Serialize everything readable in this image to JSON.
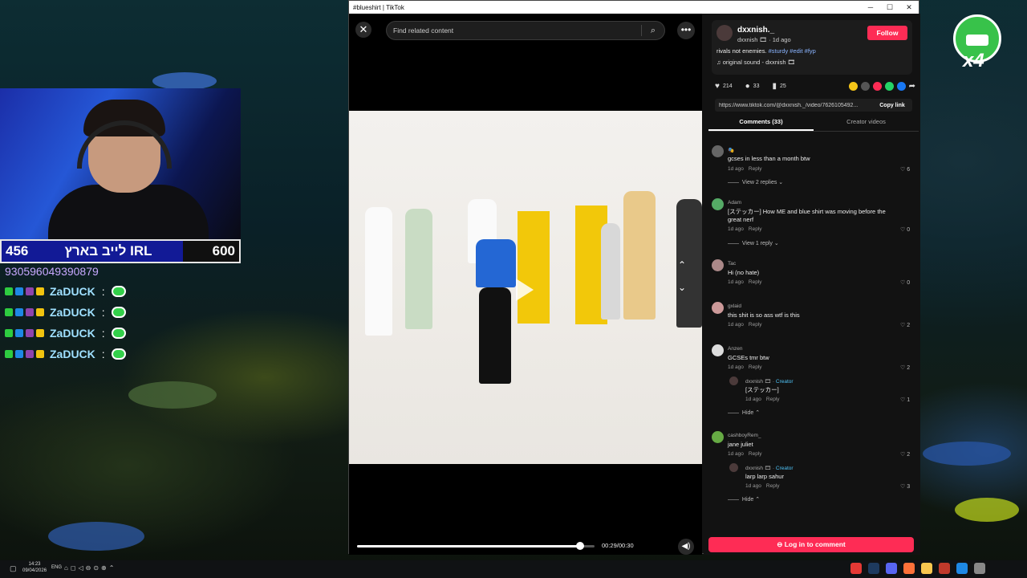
{
  "browser": {
    "title": "#blueshirt | TikTok",
    "controls": {
      "minimize": "─",
      "maximize": "☐",
      "close": "✕"
    }
  },
  "player": {
    "search_placeholder": "Find related content",
    "elapsed": "00:29/00:30",
    "progress": 0.94
  },
  "author": {
    "username": "dxxnish._",
    "handle_meta": "dxxnish 🎞 · 1d ago",
    "follow_label": "Follow",
    "caption_text": "rivals not enemies.",
    "hashtags": "#sturdy #edit #fyp",
    "music": "♫ original sound - dxxnish 🎞"
  },
  "actions": {
    "likes": "214",
    "comments": "33",
    "saves": "25"
  },
  "link": {
    "url": "https://www.tiktok.com/@dxxnish._/video/7626105492...",
    "copy_label": "Copy link"
  },
  "tabs": {
    "comments": "Comments (33)",
    "creator": "Creator videos"
  },
  "comments": [
    {
      "name": "🎭",
      "text": "gcses in less than a month btw",
      "time": "1d ago",
      "reply": "Reply",
      "likes": "6",
      "view_replies": "View 2 replies ⌄"
    },
    {
      "name": "Adam",
      "text": "[ステッカー] How ME and blue shirt was moving before the great nerf",
      "time": "1d ago",
      "reply": "Reply",
      "likes": "0",
      "view_replies": "View 1 reply ⌄"
    },
    {
      "name": "Tac",
      "text": "Hi (no hate)",
      "time": "1d ago",
      "reply": "Reply",
      "likes": "0"
    },
    {
      "name": "gxlaid",
      "text": "this shit is so ass wtf is this",
      "time": "1d ago",
      "reply": "Reply",
      "likes": "2"
    },
    {
      "name": "Anzen",
      "text": "GCSEs tmr btw",
      "time": "1d ago",
      "reply": "Reply",
      "likes": "2",
      "sub": {
        "name": "dxxnish 🎞 · ",
        "creator": "Creator",
        "text": "[ステッカー]",
        "time": "1d ago",
        "reply": "Reply",
        "likes": "1"
      },
      "hide": "Hide ⌃"
    },
    {
      "name": "cashboyRem_",
      "text": "jane juliet",
      "time": "1d ago",
      "reply": "Reply",
      "likes": "2",
      "sub": {
        "name": "dxxnish 🎞 · ",
        "creator": "Creator",
        "text": "larp larp sahur",
        "time": "1d ago",
        "reply": "Reply",
        "likes": "3"
      },
      "hide": "Hide ⌃"
    }
  ],
  "login_label": "⊖ Log in to comment",
  "stream": {
    "score_left": "456",
    "score_title": "לייב בארץ IRL",
    "score_right": "600",
    "number_line": "930596049390879",
    "chat_name": "ZaDUCK",
    "chat_colon": ":",
    "multiplier": "x4"
  },
  "taskbar": {
    "time": "14:23",
    "date": "09/04/2026",
    "lang": "ENG"
  },
  "colors": {
    "accent": "#fe2c55",
    "tag": "#8ab4ff",
    "creator": "#4fc3f7"
  }
}
